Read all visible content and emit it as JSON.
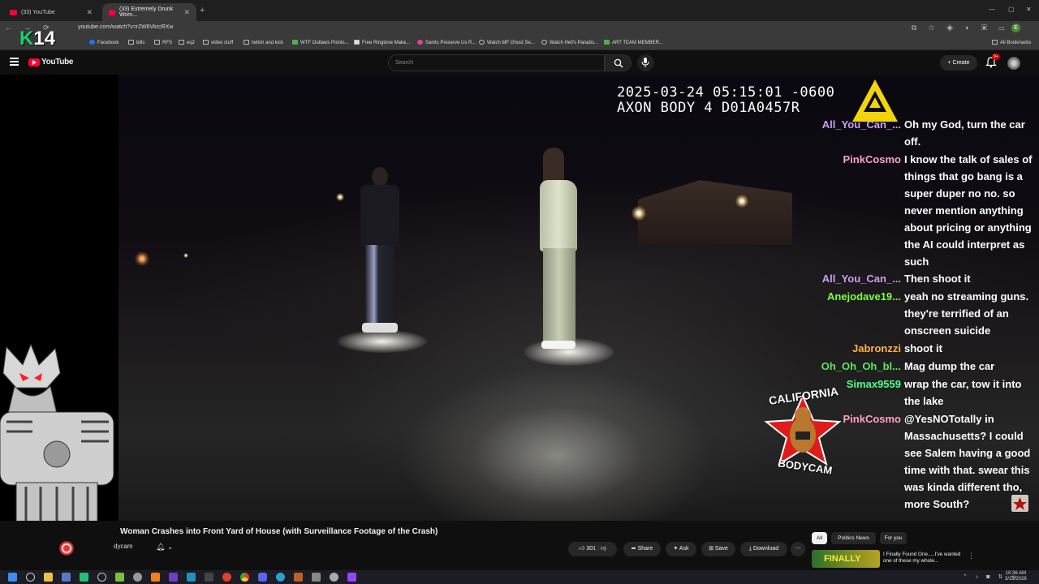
{
  "browser": {
    "tabs": [
      {
        "title": "(33) YouTube"
      },
      {
        "title": "(33) Extremely Drunk Wom..."
      }
    ],
    "url": "youtube.com/watch?v=r2W6VkrcRXw",
    "profile_initial": "E",
    "bookmarks": [
      "Facebook",
      "bills",
      "RFS",
      "eq2",
      "video stuff",
      "twitch and kick",
      "WTF Outlaws Points...",
      "Free Ringtone Make...",
      "Saints Preserve Us R...",
      "Watch MF Ghost Se...",
      "Watch Hell's Paradis...",
      "ART TEAM MEMBER..."
    ],
    "all_bookmarks": "All Bookmarks"
  },
  "overlay_logo": {
    "letter": "K",
    "number": "14"
  },
  "youtube": {
    "logo_text": "YouTube",
    "search_placeholder": "Search",
    "create_label": "Create",
    "notification_badge": "9+"
  },
  "video": {
    "timestamp_line1": "2025-03-24 05:15:01 -0600",
    "timestamp_line2": "AXON BODY 4 D01A0457R",
    "badge_top": "CALIFORNIA",
    "badge_bottom": "BODYCAM"
  },
  "chat": [
    {
      "name": "All_You_Can_...",
      "color": "#c9a0f0",
      "text": "Oh my God, turn the car off."
    },
    {
      "name": "PinkCosmo",
      "color": "#ff9fc8",
      "text": "I know the talk of sales of things that go bang is a super duper no no. so never mention anything about pricing or anything the AI could interpret as such"
    },
    {
      "name": "All_You_Can_...",
      "color": "#c9a0f0",
      "text": "Then shoot it"
    },
    {
      "name": "Anejodave19...",
      "color": "#7dff4a",
      "text": "yeah no streaming guns. they're terrified of an onscreen suicide"
    },
    {
      "name": "Jabronzzi",
      "color": "#ffb347",
      "text": "shoot it"
    },
    {
      "name": "Oh_Oh_Oh_bl...",
      "color": "#5ce65c",
      "text": "Mag dump the car"
    },
    {
      "name": "Simax9559",
      "color": "#4dff88",
      "text": "wrap the car, tow it into the lake"
    },
    {
      "name": "PinkCosmo",
      "color": "#ff9fc8",
      "text": "@YesNOTotally in Massachusetts? I could see Salem having a good time with that. swear this was kinda different tho, more South?"
    }
  ],
  "below_video": {
    "title": "Woman Crashes into Front Yard of House (with Surveillance Footage of the Crash)",
    "channel_name": "dycam",
    "like_count": "301",
    "share_label": "Share",
    "ask_label": "Ask",
    "save_label": "Save",
    "download_label": "Download",
    "chips": [
      "All",
      "Politics News",
      "For you"
    ],
    "rec_thumb_text": "FINALLY",
    "rec_title": "I Finally Found One.....I've wanted one of these my whole..."
  },
  "taskbar": {
    "time": "10:36 AM",
    "date": "3/13/2026"
  }
}
